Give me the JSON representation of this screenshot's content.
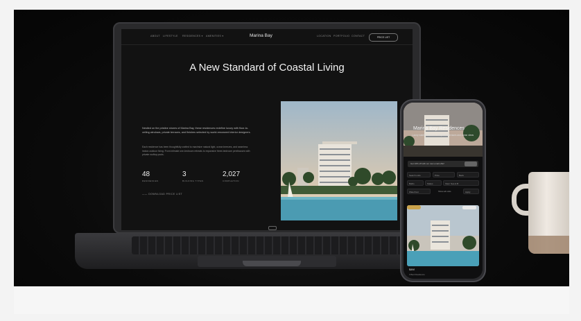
{
  "scene": {
    "laptop_screen": {
      "nav_items_left": [
        "ABOUT",
        "LIFESTYLE",
        "RESIDENCES ▾",
        "AMENITIES ▾"
      ],
      "brand": "Marina Bay",
      "nav_items_right": [
        "LOCATION",
        "PORTFOLIO",
        "CONTACT"
      ],
      "nav_button": "PRICE LIST",
      "hero_title": "A New Standard of Coastal Living",
      "paragraph_1": "Nestled on the pristine shores of Marina Bay, these residences redefine luxury with floor-to-ceiling windows, private terraces, and finishes selected by world-renowned interior designers.",
      "paragraph_2": "Each residence has been thoughtfully crafted to maximize natural light, ocean breezes, and seamless indoor-outdoor living. From intimate one-bedroom retreats to expansive three-bedroom penthouses with private rooftop pools.",
      "stats": [
        {
          "value": "48",
          "label": "RESIDENCES"
        },
        {
          "value": "3",
          "label": "BUILDING TYPES"
        },
        {
          "value": "2,027",
          "label": "COMPLETION"
        }
      ],
      "link_text": "——  DOWNLOAD PRICE LIST"
    },
    "phone_screen": {
      "title": "Marina Bay Residences",
      "subtitle": "Luxury waterfront homes with private terraces and ocean views",
      "banner_text": "Get 10% off with our new email offer!",
      "fields": [
        "Search units",
        "Price",
        "Beds",
        "Baths",
        "Status",
        "View: Sea & B",
        "Waterfront",
        "Show all units",
        "Apply"
      ],
      "card_price": "$4M",
      "card_caption": "3 Bed Residence"
    }
  }
}
